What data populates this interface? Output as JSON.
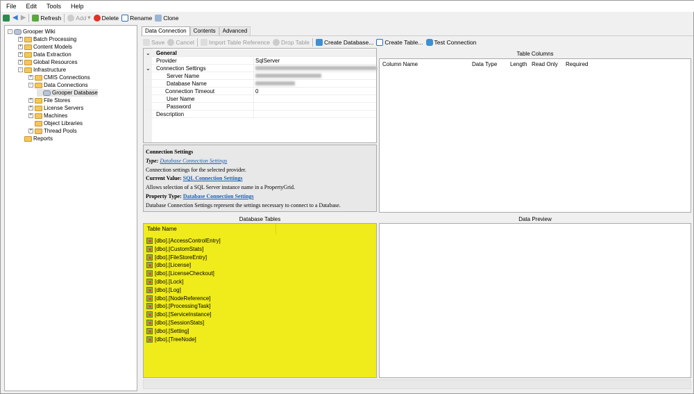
{
  "menu": [
    "File",
    "Edit",
    "Tools",
    "Help"
  ],
  "toolbar": {
    "refresh": "Refresh",
    "add": "Add",
    "delete": "Delete",
    "rename": "Rename",
    "clone": "Clone"
  },
  "tree": [
    {
      "label": "Grooper Wiki",
      "level": 0,
      "exp": "-"
    },
    {
      "label": "Batch Processing",
      "level": 1,
      "exp": "+"
    },
    {
      "label": "Content Models",
      "level": 1,
      "exp": "+"
    },
    {
      "label": "Data Extraction",
      "level": 1,
      "exp": "+"
    },
    {
      "label": "Global Resources",
      "level": 1,
      "exp": "+"
    },
    {
      "label": "Infrastructure",
      "level": 1,
      "exp": "-"
    },
    {
      "label": "CMIS Connections",
      "level": 2,
      "exp": "+"
    },
    {
      "label": "Data Connections",
      "level": 2,
      "exp": "-"
    },
    {
      "label": "Grooper Database",
      "level": 3,
      "exp": "",
      "selected": true
    },
    {
      "label": "File Stores",
      "level": 2,
      "exp": "+"
    },
    {
      "label": "License Servers",
      "level": 2,
      "exp": "+"
    },
    {
      "label": "Machines",
      "level": 2,
      "exp": "+"
    },
    {
      "label": "Object Libraries",
      "level": 2,
      "exp": ""
    },
    {
      "label": "Thread Pools",
      "level": 2,
      "exp": "+"
    },
    {
      "label": "Reports",
      "level": 1,
      "exp": ""
    }
  ],
  "tabs": [
    "Data Connection",
    "Contents",
    "Advanced"
  ],
  "actions": {
    "save": "Save",
    "cancel": "Cancel",
    "import": "Import Table Reference",
    "drop": "Drop Table",
    "create_db": "Create Database...",
    "create_table": "Create Table...",
    "test": "Test Connection"
  },
  "grid": {
    "category": "General",
    "provider_label": "Provider",
    "provider_value": "SqlServer",
    "conn_label": "Connection Settings",
    "server_label": "Server Name",
    "db_label": "Database Name",
    "timeout_label": "Connection Timeout",
    "timeout_value": "0",
    "user_label": "User Name",
    "password_label": "Password",
    "desc_label": "Description"
  },
  "help": {
    "title": "Connection Settings",
    "type_label": "Type:",
    "type_link": "Database Connection Settings",
    "type_desc": "Connection settings for the selected provider.",
    "cv_label": "Current Value:",
    "cv_link": "SQL Connection Settings",
    "cv_desc": "Allows selection of a SQL Server instance name in a PropertyGrid.",
    "pt_label": "Property Type:",
    "pt_link": "Database Connection Settings",
    "pt_desc": "Database Connection Settings represent the settings necessary to connect to a Database."
  },
  "table_columns": {
    "title": "Table Columns",
    "headers": [
      "Column Name",
      "Data Type",
      "Length",
      "Read Only",
      "Required"
    ]
  },
  "database_tables": {
    "title": "Database Tables",
    "header": "Table Name",
    "highlight": "#f0eb1a",
    "items": [
      "[dbo].[AccessControlEntry]",
      "[dbo].[CustomStats]",
      "[dbo].[FileStoreEntry]",
      "[dbo].[License]",
      "[dbo].[LicenseCheckout]",
      "[dbo].[Lock]",
      "[dbo].[Log]",
      "[dbo].[NodeReference]",
      "[dbo].[ProcessingTask]",
      "[dbo].[ServiceInstance]",
      "[dbo].[SessionStats]",
      "[dbo].[Setting]",
      "[dbo].[TreeNode]"
    ]
  },
  "data_preview": {
    "title": "Data Preview"
  }
}
